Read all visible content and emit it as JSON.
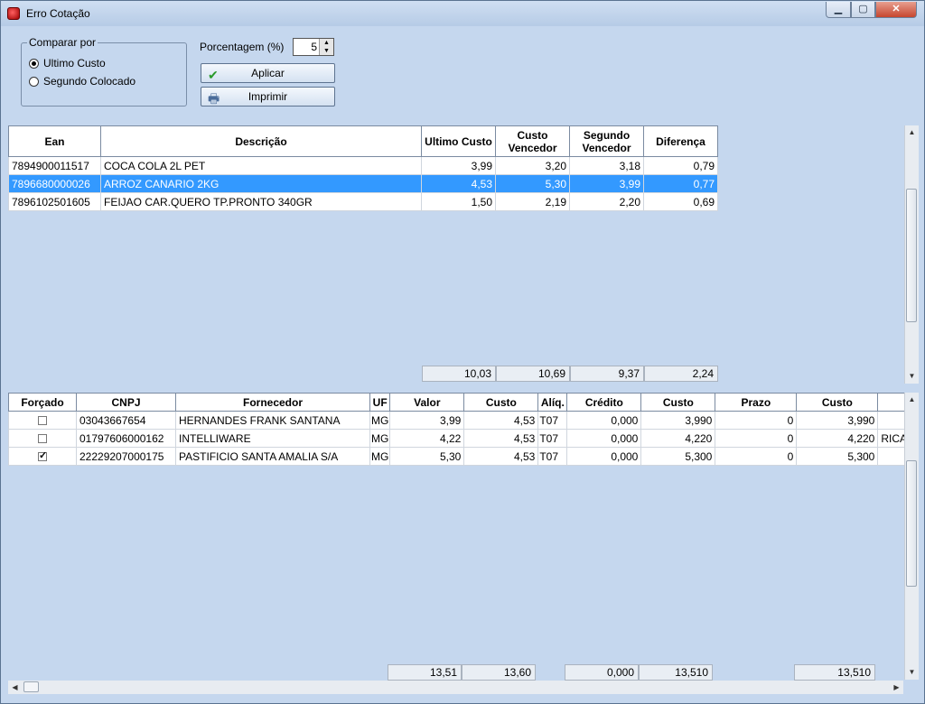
{
  "window": {
    "title": "Erro Cotação"
  },
  "compare": {
    "legend": "Comparar por",
    "options": [
      "Ultimo Custo",
      "Segundo Colocado"
    ],
    "selected": 0
  },
  "percent": {
    "label": "Porcentagem (%)",
    "value": "5"
  },
  "buttons": {
    "apply": "Aplicar",
    "print": "Imprimir"
  },
  "products": {
    "headers": [
      "Ean",
      "Descrição",
      "Ultimo Custo",
      "Custo Vencedor",
      "Segundo Vencedor",
      "Diferença"
    ],
    "rows": [
      [
        "7894900011517",
        "COCA COLA 2L PET",
        "3,99",
        "3,20",
        "3,18",
        "0,79"
      ],
      [
        "7896680000026",
        "ARROZ CANARIO 2KG",
        "4,53",
        "5,30",
        "3,99",
        "0,77"
      ],
      [
        "7896102501605",
        "FEIJAO CAR.QUERO TP.PRONTO 340GR",
        "1,50",
        "2,19",
        "2,20",
        "0,69"
      ]
    ],
    "selected_row": 1,
    "totals": [
      "10,03",
      "10,69",
      "9,37",
      "2,24"
    ]
  },
  "suppliers": {
    "headers": [
      "Forçado",
      "CNPJ",
      "Fornecedor",
      "UF",
      "Valor",
      "Custo",
      "Alíq.",
      "Crédito",
      "Custo",
      "Prazo",
      "Custo",
      ""
    ],
    "rows": [
      {
        "forced": false,
        "cells": [
          "03043667654",
          "HERNANDES FRANK SANTANA",
          "MG",
          "3,99",
          "4,53",
          "T07",
          "0,000",
          "3,990",
          "0",
          "3,990",
          ""
        ]
      },
      {
        "forced": false,
        "cells": [
          "01797606000162",
          "INTELLIWARE",
          "MG",
          "4,22",
          "4,53",
          "T07",
          "0,000",
          "4,220",
          "0",
          "4,220",
          "RICA"
        ]
      },
      {
        "forced": true,
        "cells": [
          "22229207000175",
          "PASTIFICIO SANTA AMALIA S/A",
          "MG",
          "5,30",
          "4,53",
          "T07",
          "0,000",
          "5,300",
          "0",
          "5,300",
          ""
        ]
      }
    ],
    "totals": [
      "13,51",
      "13,60",
      "0,000",
      "13,510",
      "13,510"
    ]
  }
}
